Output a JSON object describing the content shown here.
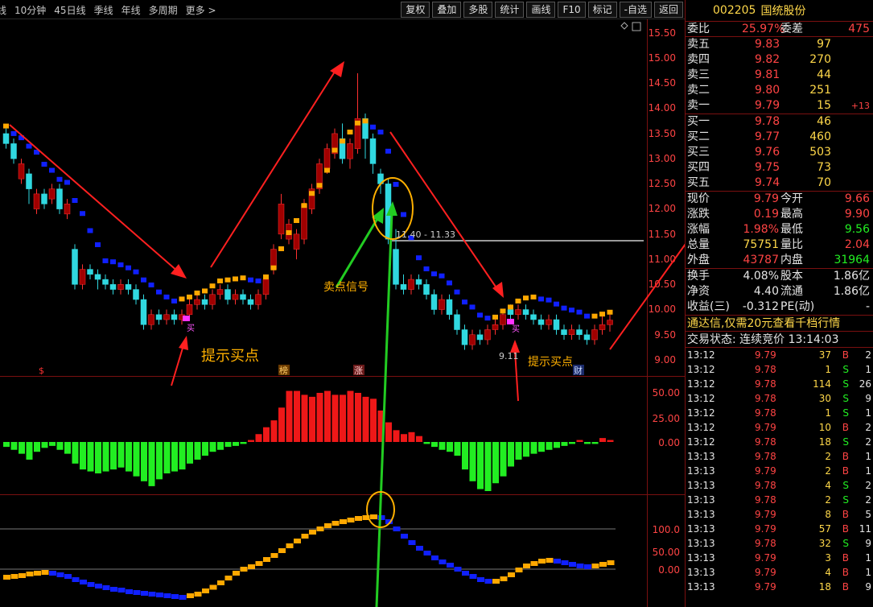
{
  "toolbar": {
    "periods": [
      "线",
      "10分钟",
      "45日线",
      "季线",
      "年线",
      "多周期",
      "更多 >"
    ],
    "buttons": [
      "复权",
      "叠加",
      "多股",
      "统计",
      "画线",
      "F10",
      "标记",
      "-自选",
      "返回"
    ]
  },
  "price_axis": [
    "15.50",
    "15.00",
    "14.50",
    "14.00",
    "13.50",
    "13.00",
    "12.50",
    "12.00",
    "11.50",
    "11.00",
    "10.50",
    "10.00",
    "9.50",
    "9.00"
  ],
  "macd_axis": [
    "50.00",
    "25.00",
    "0.00"
  ],
  "kdj_axis": [
    "100.0",
    "50.00",
    "0.00"
  ],
  "annotations": {
    "buy_hint_left": "提示买点",
    "buy_hint_right": "提示买点",
    "sell_signal": "卖点信号",
    "line_label": "11.40 - 11.33",
    "low_label": "9.11",
    "buy_mark": "买",
    "buy_mark_2": "买",
    "event_s": "$",
    "event_bang": "榜",
    "event_zhang": "涨",
    "event_cai": "财"
  },
  "stock": {
    "code": "002205",
    "name": "国统股份"
  },
  "order_book": {
    "weibi_label": "委比",
    "weibi_value": "25.97%",
    "weicha_label": "委差",
    "weicha_value": "475",
    "sell": [
      {
        "label": "卖五",
        "price": "9.83",
        "vol": "97",
        "chg": ""
      },
      {
        "label": "卖四",
        "price": "9.82",
        "vol": "270",
        "chg": ""
      },
      {
        "label": "卖三",
        "price": "9.81",
        "vol": "44",
        "chg": ""
      },
      {
        "label": "卖二",
        "price": "9.80",
        "vol": "251",
        "chg": ""
      },
      {
        "label": "卖一",
        "price": "9.79",
        "vol": "15",
        "chg": "+13"
      }
    ],
    "buy": [
      {
        "label": "买一",
        "price": "9.78",
        "vol": "46"
      },
      {
        "label": "买二",
        "price": "9.77",
        "vol": "460"
      },
      {
        "label": "买三",
        "price": "9.76",
        "vol": "503"
      },
      {
        "label": "买四",
        "price": "9.75",
        "vol": "73"
      },
      {
        "label": "买五",
        "price": "9.74",
        "vol": "70"
      }
    ]
  },
  "quote": [
    {
      "l1": "现价",
      "v1": "9.79",
      "c1": "red",
      "l2": "今开",
      "v2": "9.66",
      "c2": "red"
    },
    {
      "l1": "涨跌",
      "v1": "0.19",
      "c1": "red",
      "l2": "最高",
      "v2": "9.90",
      "c2": "red"
    },
    {
      "l1": "涨幅",
      "v1": "1.98%",
      "c1": "red",
      "l2": "最低",
      "v2": "9.56",
      "c2": "green"
    },
    {
      "l1": "总量",
      "v1": "75751",
      "c1": "yel",
      "l2": "量比",
      "v2": "2.04",
      "c2": "red"
    },
    {
      "l1": "外盘",
      "v1": "43787",
      "c1": "red",
      "l2": "内盘",
      "v2": "31964",
      "c2": "green"
    }
  ],
  "fundamentals": [
    {
      "l1": "换手",
      "v1": "4.08%",
      "l2": "股本",
      "v2": "1.86亿"
    },
    {
      "l1": "净资",
      "v1": "4.40",
      "l2": "流通",
      "v2": "1.86亿"
    },
    {
      "l1": "收益(三)",
      "v1": "-0.312",
      "l2": "PE(动)",
      "v2": "-"
    }
  ],
  "ad_text": "通达信,仅需20元查看千档行情",
  "status_text": "交易状态: 连续竞价 13:14:03",
  "ticks": [
    {
      "t": "13:12",
      "p": "9.79",
      "v": "37",
      "bs": "B",
      "n": "2"
    },
    {
      "t": "13:12",
      "p": "9.78",
      "v": "1",
      "bs": "S",
      "n": "1"
    },
    {
      "t": "13:12",
      "p": "9.78",
      "v": "114",
      "bs": "S",
      "n": "26"
    },
    {
      "t": "13:12",
      "p": "9.78",
      "v": "30",
      "bs": "S",
      "n": "9"
    },
    {
      "t": "13:12",
      "p": "9.78",
      "v": "1",
      "bs": "S",
      "n": "1"
    },
    {
      "t": "13:12",
      "p": "9.79",
      "v": "10",
      "bs": "B",
      "n": "2"
    },
    {
      "t": "13:12",
      "p": "9.78",
      "v": "18",
      "bs": "S",
      "n": "2"
    },
    {
      "t": "13:13",
      "p": "9.78",
      "v": "2",
      "bs": "B",
      "n": "1"
    },
    {
      "t": "13:13",
      "p": "9.79",
      "v": "2",
      "bs": "B",
      "n": "1"
    },
    {
      "t": "13:13",
      "p": "9.78",
      "v": "4",
      "bs": "S",
      "n": "2"
    },
    {
      "t": "13:13",
      "p": "9.78",
      "v": "2",
      "bs": "S",
      "n": "2"
    },
    {
      "t": "13:13",
      "p": "9.79",
      "v": "8",
      "bs": "B",
      "n": "5"
    },
    {
      "t": "13:13",
      "p": "9.79",
      "v": "57",
      "bs": "B",
      "n": "11"
    },
    {
      "t": "13:13",
      "p": "9.78",
      "v": "32",
      "bs": "S",
      "n": "9"
    },
    {
      "t": "13:13",
      "p": "9.79",
      "v": "3",
      "bs": "B",
      "n": "1"
    },
    {
      "t": "13:13",
      "p": "9.79",
      "v": "4",
      "bs": "B",
      "n": "1"
    },
    {
      "t": "13:13",
      "p": "9.79",
      "v": "18",
      "bs": "B",
      "n": "9"
    }
  ],
  "candles": [
    [
      13.5,
      13.3,
      13.6,
      13.2
    ],
    [
      13.3,
      13.0,
      13.4,
      12.9
    ],
    [
      12.6,
      12.9,
      13.0,
      12.5
    ],
    [
      12.7,
      12.4,
      12.8,
      12.1
    ],
    [
      12.0,
      12.3,
      12.4,
      11.9
    ],
    [
      12.3,
      12.1,
      12.4,
      12.0
    ],
    [
      12.2,
      12.4,
      12.5,
      12.1
    ],
    [
      12.4,
      12.0,
      12.5,
      11.9
    ],
    [
      11.9,
      12.1,
      12.2,
      11.8
    ],
    [
      11.2,
      10.5,
      11.3,
      10.4
    ],
    [
      10.5,
      10.8,
      10.9,
      10.4
    ],
    [
      10.8,
      10.7,
      10.9,
      10.6
    ],
    [
      10.7,
      10.6,
      10.8,
      10.4
    ],
    [
      10.6,
      10.5,
      10.7,
      10.4
    ],
    [
      10.5,
      10.4,
      10.6,
      10.3
    ],
    [
      10.4,
      10.5,
      10.6,
      10.3
    ],
    [
      10.5,
      10.4,
      10.6,
      10.3
    ],
    [
      10.4,
      10.2,
      10.5,
      10.1
    ],
    [
      10.2,
      9.7,
      10.3,
      9.6
    ],
    [
      9.7,
      9.9,
      10.0,
      9.6
    ],
    [
      9.9,
      9.8,
      10.0,
      9.7
    ],
    [
      9.8,
      9.9,
      10.0,
      9.7
    ],
    [
      9.9,
      9.8,
      10.0,
      9.7
    ],
    [
      9.8,
      9.9,
      10.0,
      9.7
    ],
    [
      9.9,
      10.1,
      10.2,
      9.8
    ],
    [
      10.1,
      10.2,
      10.3,
      10.0
    ],
    [
      10.2,
      10.1,
      10.3,
      10.0
    ],
    [
      10.1,
      10.3,
      10.4,
      10.0
    ],
    [
      10.3,
      10.4,
      10.5,
      10.2
    ],
    [
      10.4,
      10.2,
      10.5,
      10.1
    ],
    [
      10.2,
      10.3,
      10.4,
      10.1
    ],
    [
      10.3,
      10.2,
      10.4,
      10.1
    ],
    [
      10.2,
      10.1,
      10.3,
      10.0
    ],
    [
      10.1,
      10.3,
      10.4,
      10.0
    ],
    [
      10.3,
      10.6,
      10.7,
      10.2
    ],
    [
      10.8,
      11.2,
      11.3,
      10.7
    ],
    [
      11.5,
      12.1,
      12.3,
      11.4
    ],
    [
      11.4,
      11.7,
      11.8,
      11.3
    ],
    [
      11.2,
      11.5,
      11.6,
      11.0
    ],
    [
      11.4,
      12.1,
      12.2,
      11.3
    ],
    [
      12.0,
      12.4,
      12.5,
      11.9
    ],
    [
      12.4,
      12.9,
      13.0,
      12.3
    ],
    [
      12.8,
      13.2,
      13.3,
      12.7
    ],
    [
      13.1,
      13.5,
      13.6,
      13.0
    ],
    [
      13.4,
      13.0,
      13.7,
      12.9
    ],
    [
      13.0,
      13.3,
      13.4,
      12.8
    ],
    [
      13.2,
      13.8,
      14.7,
      13.1
    ],
    [
      13.8,
      13.4,
      13.9,
      13.0
    ],
    [
      13.4,
      12.9,
      13.5,
      12.7
    ],
    [
      12.7,
      12.5,
      12.8,
      12.3
    ],
    [
      12.5,
      11.4,
      12.6,
      11.3
    ],
    [
      11.2,
      10.5,
      11.6,
      10.4
    ],
    [
      10.5,
      10.4,
      10.7,
      10.3
    ],
    [
      10.4,
      10.6,
      10.7,
      10.3
    ],
    [
      10.6,
      10.5,
      10.7,
      10.4
    ],
    [
      10.5,
      10.3,
      10.6,
      10.2
    ],
    [
      10.3,
      10.0,
      10.4,
      9.9
    ],
    [
      10.0,
      10.2,
      10.3,
      9.9
    ],
    [
      10.2,
      9.9,
      10.3,
      9.8
    ],
    [
      9.9,
      9.6,
      10.0,
      9.5
    ],
    [
      9.6,
      9.3,
      9.7,
      9.2
    ],
    [
      9.3,
      9.5,
      9.6,
      9.2
    ],
    [
      9.5,
      9.4,
      9.6,
      9.3
    ],
    [
      9.4,
      9.6,
      9.7,
      9.3
    ],
    [
      9.6,
      9.7,
      9.8,
      9.5
    ],
    [
      9.7,
      9.9,
      10.0,
      9.6
    ],
    [
      10.0,
      9.9,
      10.1,
      9.8
    ],
    [
      9.9,
      10.0,
      10.1,
      9.8
    ],
    [
      10.0,
      9.9,
      10.1,
      9.8
    ],
    [
      9.9,
      9.8,
      10.0,
      9.7
    ],
    [
      9.8,
      9.7,
      9.9,
      9.6
    ],
    [
      9.7,
      9.8,
      9.9,
      9.6
    ],
    [
      9.8,
      9.6,
      9.9,
      9.5
    ],
    [
      9.6,
      9.5,
      9.7,
      9.4
    ],
    [
      9.5,
      9.6,
      9.7,
      9.4
    ],
    [
      9.6,
      9.5,
      9.7,
      9.4
    ],
    [
      9.5,
      9.4,
      9.6,
      9.3
    ],
    [
      9.4,
      9.6,
      9.7,
      9.3
    ],
    [
      9.6,
      9.7,
      9.9,
      9.5
    ],
    [
      9.7,
      9.79,
      9.9,
      9.56
    ]
  ],
  "macd": [
    -5,
    -8,
    -12,
    -18,
    -10,
    -6,
    -4,
    -8,
    -12,
    -22,
    -28,
    -30,
    -32,
    -30,
    -28,
    -26,
    -30,
    -35,
    -40,
    -45,
    -38,
    -32,
    -30,
    -28,
    -22,
    -18,
    -14,
    -10,
    -8,
    -5,
    -4,
    -2,
    2,
    8,
    15,
    22,
    35,
    52,
    52,
    48,
    46,
    50,
    52,
    48,
    48,
    52,
    50,
    46,
    44,
    32,
    20,
    12,
    8,
    10,
    6,
    -2,
    -5,
    -8,
    -10,
    -14,
    -28,
    -40,
    -48,
    -50,
    -42,
    -35,
    -25,
    -18,
    -15,
    -12,
    -10,
    -8,
    -6,
    -4,
    -2,
    2,
    -2,
    -2,
    4,
    2
  ],
  "kdj": [
    -20,
    -18,
    -16,
    -12,
    -10,
    -8,
    -10,
    -14,
    -18,
    -26,
    -32,
    -38,
    -42,
    -46,
    -50,
    -52,
    -56,
    -58,
    -60,
    -62,
    -64,
    -66,
    -68,
    -70,
    -66,
    -62,
    -54,
    -45,
    -34,
    -22,
    -10,
    0,
    6,
    14,
    24,
    34,
    46,
    58,
    70,
    82,
    92,
    100,
    108,
    114,
    118,
    122,
    126,
    128,
    130,
    128,
    118,
    100,
    82,
    66,
    52,
    40,
    28,
    18,
    10,
    0,
    -10,
    -18,
    -26,
    -30,
    -30,
    -24,
    -14,
    -2,
    8,
    14,
    20,
    22,
    20,
    16,
    12,
    8,
    6,
    8,
    12,
    16
  ]
}
